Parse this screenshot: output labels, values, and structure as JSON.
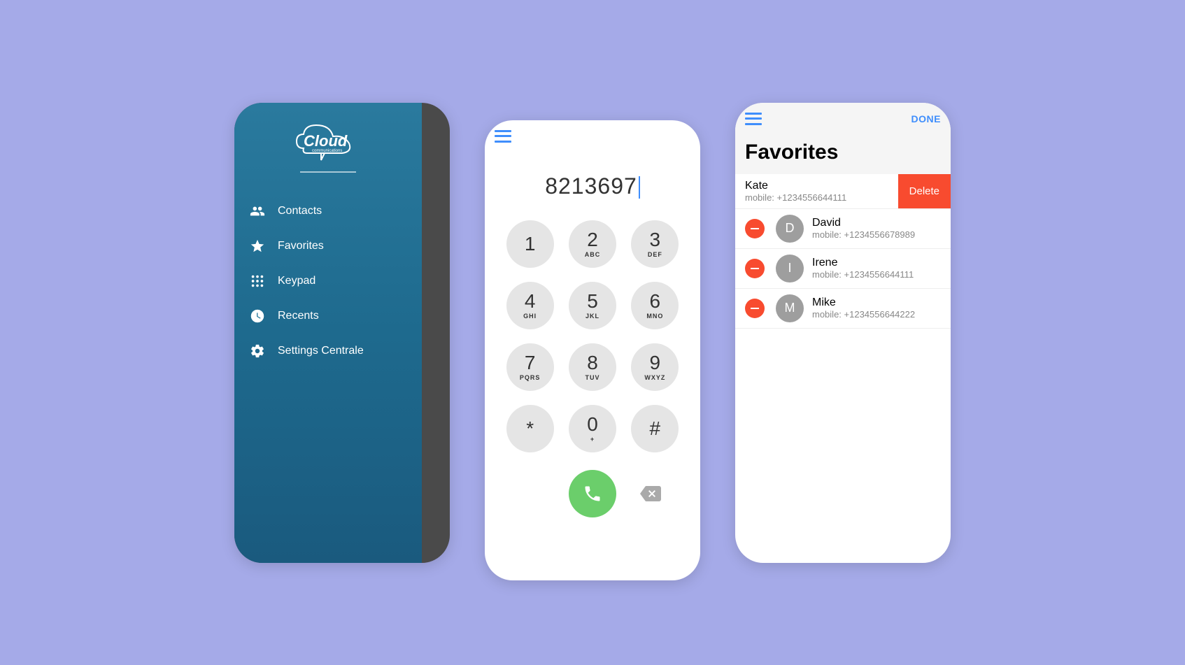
{
  "menu": {
    "logo_text": "Cloud",
    "logo_sub": "communications",
    "items": [
      {
        "label": "Contacts"
      },
      {
        "label": "Favorites"
      },
      {
        "label": "Keypad"
      },
      {
        "label": "Recents"
      },
      {
        "label": "Settings Centrale"
      }
    ]
  },
  "keypad": {
    "dialed": "8213697",
    "keys": [
      {
        "num": "1",
        "letters": ""
      },
      {
        "num": "2",
        "letters": "ABC"
      },
      {
        "num": "3",
        "letters": "DEF"
      },
      {
        "num": "4",
        "letters": "GHI"
      },
      {
        "num": "5",
        "letters": "JKL"
      },
      {
        "num": "6",
        "letters": "MNO"
      },
      {
        "num": "7",
        "letters": "PQRS"
      },
      {
        "num": "8",
        "letters": "TUV"
      },
      {
        "num": "9",
        "letters": "WXYZ"
      },
      {
        "num": "*",
        "letters": ""
      },
      {
        "num": "0",
        "letters": "+"
      },
      {
        "num": "#",
        "letters": ""
      }
    ]
  },
  "favorites": {
    "done_label": "DONE",
    "title": "Favorites",
    "delete_label": "Delete",
    "swiped": {
      "name": "Kate",
      "phone": "mobile: +1234556644111"
    },
    "list": [
      {
        "initial": "D",
        "name": "David",
        "phone": "mobile: +1234556678989"
      },
      {
        "initial": "I",
        "name": "Irene",
        "phone": "mobile: +1234556644111"
      },
      {
        "initial": "M",
        "name": "Mike",
        "phone": "mobile: +1234556644222"
      }
    ]
  }
}
